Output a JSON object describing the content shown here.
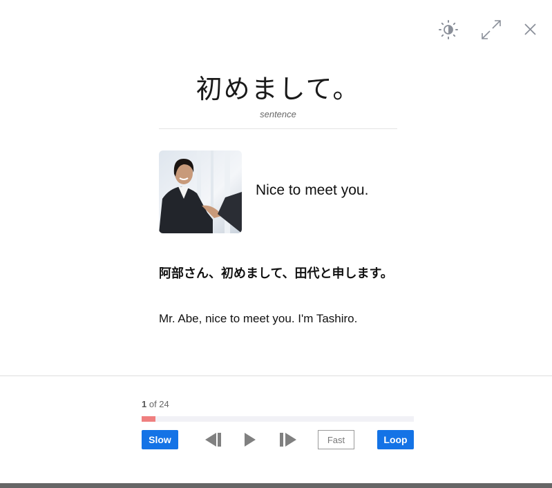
{
  "toolbar": {
    "icons": [
      "brightness-icon",
      "expand-icon",
      "close-icon"
    ]
  },
  "card": {
    "word": "初めまして。",
    "part_of_speech": "sentence",
    "meaning": "Nice to meet you.",
    "example_jp": "阿部さん、初めまして、田代と申します。",
    "example_en": "Mr. Abe, nice to meet you. I'm Tashiro."
  },
  "player": {
    "current": "1",
    "total_text": " of 24",
    "progress_fraction": 0.05,
    "slow_label": "Slow",
    "fast_label": "Fast",
    "loop_label": "Loop"
  },
  "colors": {
    "accent": "#1473e6",
    "progress": "#ef7f7f"
  }
}
